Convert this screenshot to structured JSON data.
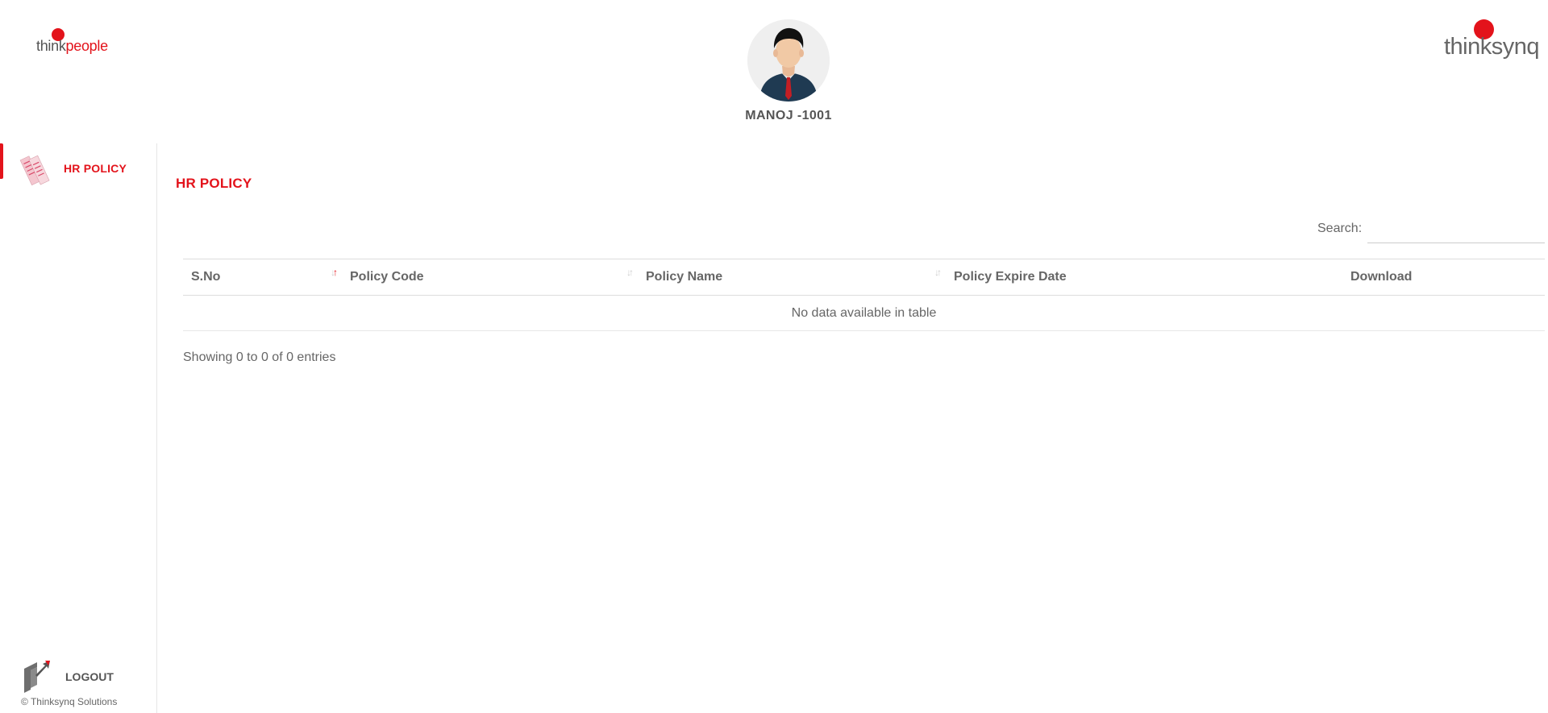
{
  "header": {
    "logo_left": {
      "think": "think",
      "people": "people"
    },
    "logo_right": {
      "text": "thinksynq"
    },
    "user_name": "MANOJ -1001"
  },
  "sidebar": {
    "items": [
      {
        "label": "HR POLICY",
        "icon": "policy-document-icon",
        "active": true
      }
    ],
    "logout": {
      "label": "LOGOUT",
      "icon": "logout-icon"
    },
    "copyright": "© Thinksynq Solutions"
  },
  "main": {
    "title": "HR POLICY",
    "search": {
      "label": "Search:",
      "value": "",
      "placeholder": ""
    },
    "table": {
      "columns": [
        "S.No",
        "Policy Code",
        "Policy Name",
        "Policy Expire Date",
        "Download"
      ],
      "empty_message": "No data available in table"
    },
    "info": "Showing 0 to 0 of 0 entries"
  },
  "colors": {
    "accent": "#e3131b",
    "text": "#666666",
    "border": "#dddddd"
  }
}
